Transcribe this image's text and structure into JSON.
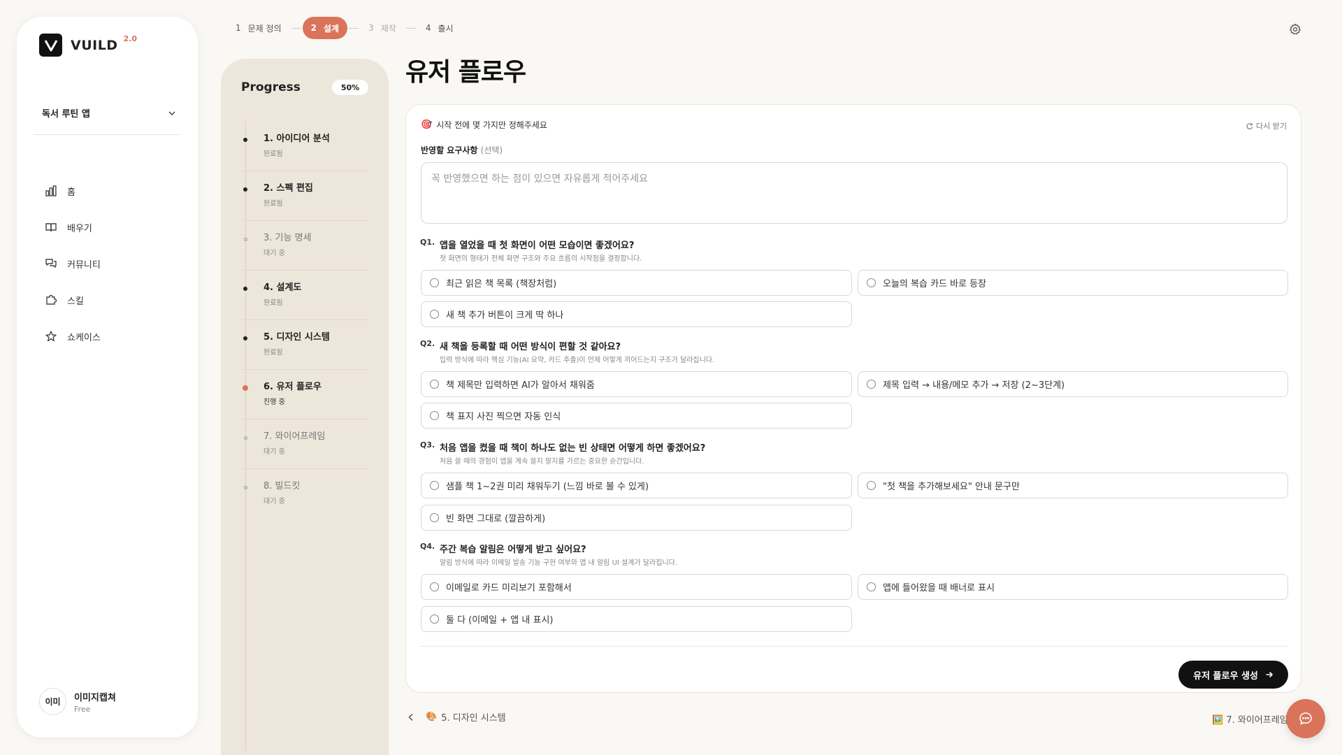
{
  "app": {
    "name": "VUILD",
    "version": "2.0"
  },
  "sidebar": {
    "project": "독서 루틴 앱",
    "nav": [
      {
        "label": "홈",
        "icon": "bar-chart-icon"
      },
      {
        "label": "배우기",
        "icon": "book-icon"
      },
      {
        "label": "커뮤니티",
        "icon": "chat-bubbles-icon"
      },
      {
        "label": "스킬",
        "icon": "puzzle-icon"
      },
      {
        "label": "쇼케이스",
        "icon": "star-icon"
      }
    ],
    "user": {
      "initials": "이미",
      "name": "이미지캡쳐",
      "plan": "Free"
    }
  },
  "stepper": [
    {
      "num": "1",
      "label": "문제 정의"
    },
    {
      "num": "2",
      "label": "설계"
    },
    {
      "num": "3",
      "label": "제작"
    },
    {
      "num": "4",
      "label": "출시"
    }
  ],
  "progress": {
    "title": "Progress",
    "percent": "50%",
    "items": [
      {
        "label": "1. 아이디어 분석",
        "status": "완료됨"
      },
      {
        "label": "2. 스펙 편집",
        "status": "완료됨"
      },
      {
        "label": "3. 기능 명세",
        "status": "대기 중"
      },
      {
        "label": "4. 설계도",
        "status": "완료됨"
      },
      {
        "label": "5. 디자인 시스템",
        "status": "완료됨"
      },
      {
        "label": "6. 유저 플로우",
        "status": "진행 중"
      },
      {
        "label": "7. 와이어프레임",
        "status": "대기 중"
      },
      {
        "label": "8. 빌드킷",
        "status": "대기 중"
      }
    ]
  },
  "main": {
    "title": "유저 플로우",
    "intro": "시작 전에 몇 가지만 정해주세요",
    "intro_icon": "🎯",
    "refresh": "다시 받기",
    "req_label": "반영할 요구사항",
    "req_optional": "(선택)",
    "req_placeholder": "꼭 반영했으면 하는 점이 있으면 자유롭게 적어주세요",
    "questions": [
      {
        "num": "Q1.",
        "text": "앱을 열었을 때 첫 화면이 어떤 모습이면 좋겠어요?",
        "desc": "첫 화면의 형태가 전체 화면 구조와 주요 흐름의 시작점을 결정합니다.",
        "options": [
          "최근 읽은 책 목록 (책장처럼)",
          "오늘의 복습 카드 바로 등장",
          "새 책 추가 버튼이 크게 딱 하나"
        ]
      },
      {
        "num": "Q2.",
        "text": "새 책을 등록할 때 어떤 방식이 편할 것 같아요?",
        "desc": "입력 방식에 따라 핵심 기능(AI 요약, 카드 추출)이 언제 어떻게 끼어드는지 구조가 달라집니다.",
        "options": [
          "책 제목만 입력하면 AI가 알아서 채워줌",
          "제목 입력 → 내용/메모 추가 → 저장 (2~3단계)",
          "책 표지 사진 찍으면 자동 인식"
        ]
      },
      {
        "num": "Q3.",
        "text": "처음 앱을 켰을 때 책이 하나도 없는 빈 상태면 어떻게 하면 좋겠어요?",
        "desc": "처음 쓸 때의 경험이 앱을 계속 쓸지 말지를 가르는 중요한 순간입니다.",
        "options": [
          "샘플 책 1~2권 미리 채워두기 (느낌 바로 볼 수 있게)",
          "\"첫 책을 추가해보세요\" 안내 문구만",
          "빈 화면 그대로 (깔끔하게)"
        ]
      },
      {
        "num": "Q4.",
        "text": "주간 복습 알림은 어떻게 받고 싶어요?",
        "desc": "알림 방식에 따라 이메일 발송 기능 구현 여부와 앱 내 알림 UI 설계가 달라집니다.",
        "options": [
          "이메일로 카드 미리보기 포함해서",
          "앱에 들어왔을 때 배너로 표시",
          "둘 다 (이메일 + 앱 내 표시)"
        ]
      }
    ],
    "generate_button": "유저 플로우 생성",
    "prev_link": "5. 디자인 시스템",
    "prev_icon": "🎨",
    "next_link": "7. 와이어프레임",
    "next_icon": "🖼️"
  },
  "colors": {
    "accent": "#d9745a",
    "panel": "#ede6da",
    "background": "#faf8f4",
    "dark": "#111111"
  }
}
